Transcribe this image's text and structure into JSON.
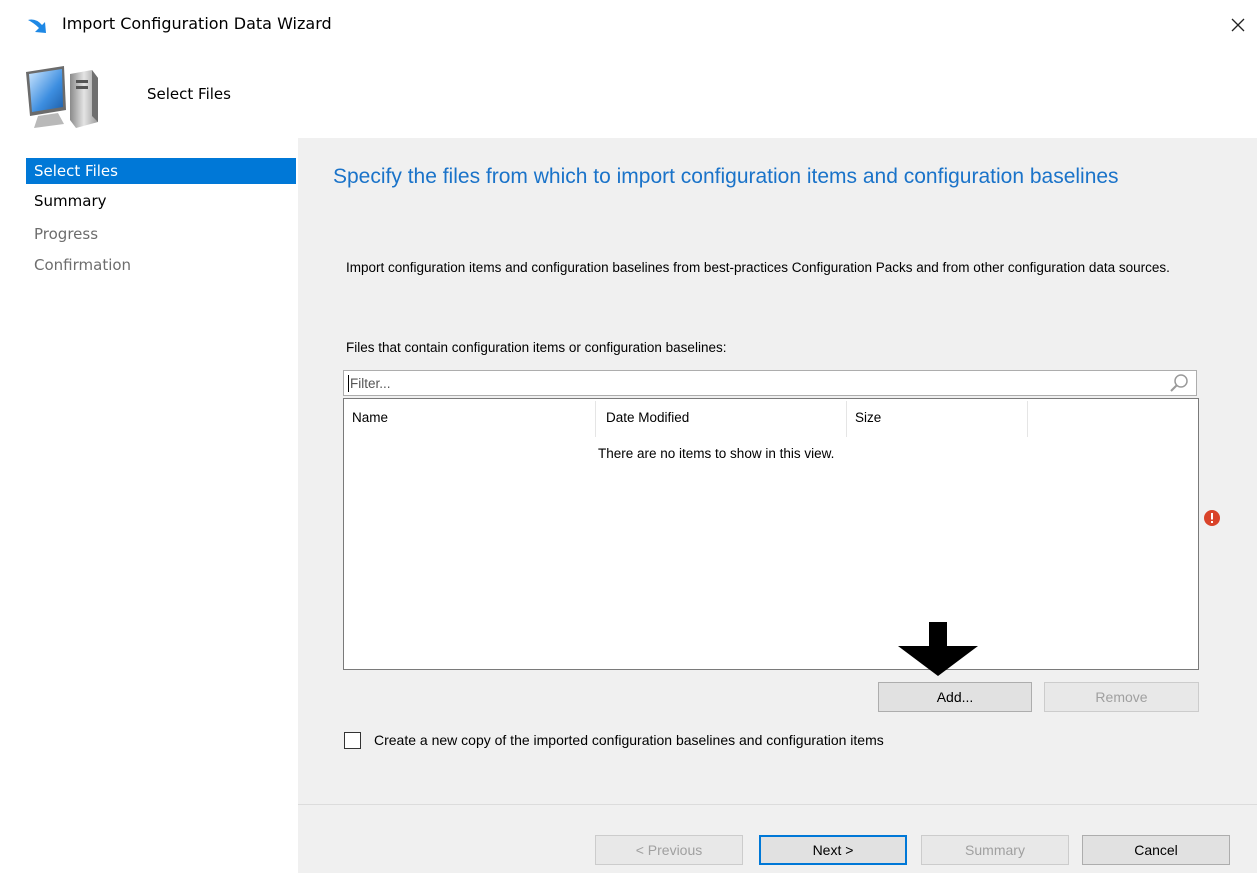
{
  "window": {
    "title": "Import Configuration Data Wizard",
    "close_glyph": "✕"
  },
  "header": {
    "title": "Select Files"
  },
  "sidebar": {
    "items": [
      {
        "label": "Select Files",
        "state": "active"
      },
      {
        "label": "Summary",
        "state": "normal"
      },
      {
        "label": "Progress",
        "state": "disabled"
      },
      {
        "label": "Confirmation",
        "state": "disabled"
      }
    ]
  },
  "main": {
    "heading": "Specify the files from which to import configuration items and configuration baselines",
    "description": "Import configuration items and configuration baselines from best-practices Configuration Packs and from other configuration data sources.",
    "files_label": "Files that contain configuration items or configuration baselines:",
    "filter": {
      "placeholder": "Filter...",
      "value": ""
    },
    "list": {
      "columns": [
        "Name",
        "Date Modified",
        "Size"
      ],
      "empty_message": "There are no items to show in this view."
    },
    "add_button": "Add...",
    "remove_button": "Remove",
    "checkbox": {
      "label": "Create a new copy of the imported configuration baselines and configuration items",
      "checked": false
    }
  },
  "footer": {
    "previous_button": "< Previous",
    "next_button": "Next >",
    "summary_button": "Summary",
    "cancel_button": "Cancel"
  },
  "icons": {
    "title": "wizard-arrow-icon",
    "header": "computer-icon",
    "search": "search-icon",
    "error": "error-icon",
    "annotation": "down-arrow-annotation"
  },
  "colors": {
    "accent": "#0078d7",
    "heading": "#1a73c9",
    "panel_bg": "#f0f0f0",
    "error": "#d9432a"
  }
}
